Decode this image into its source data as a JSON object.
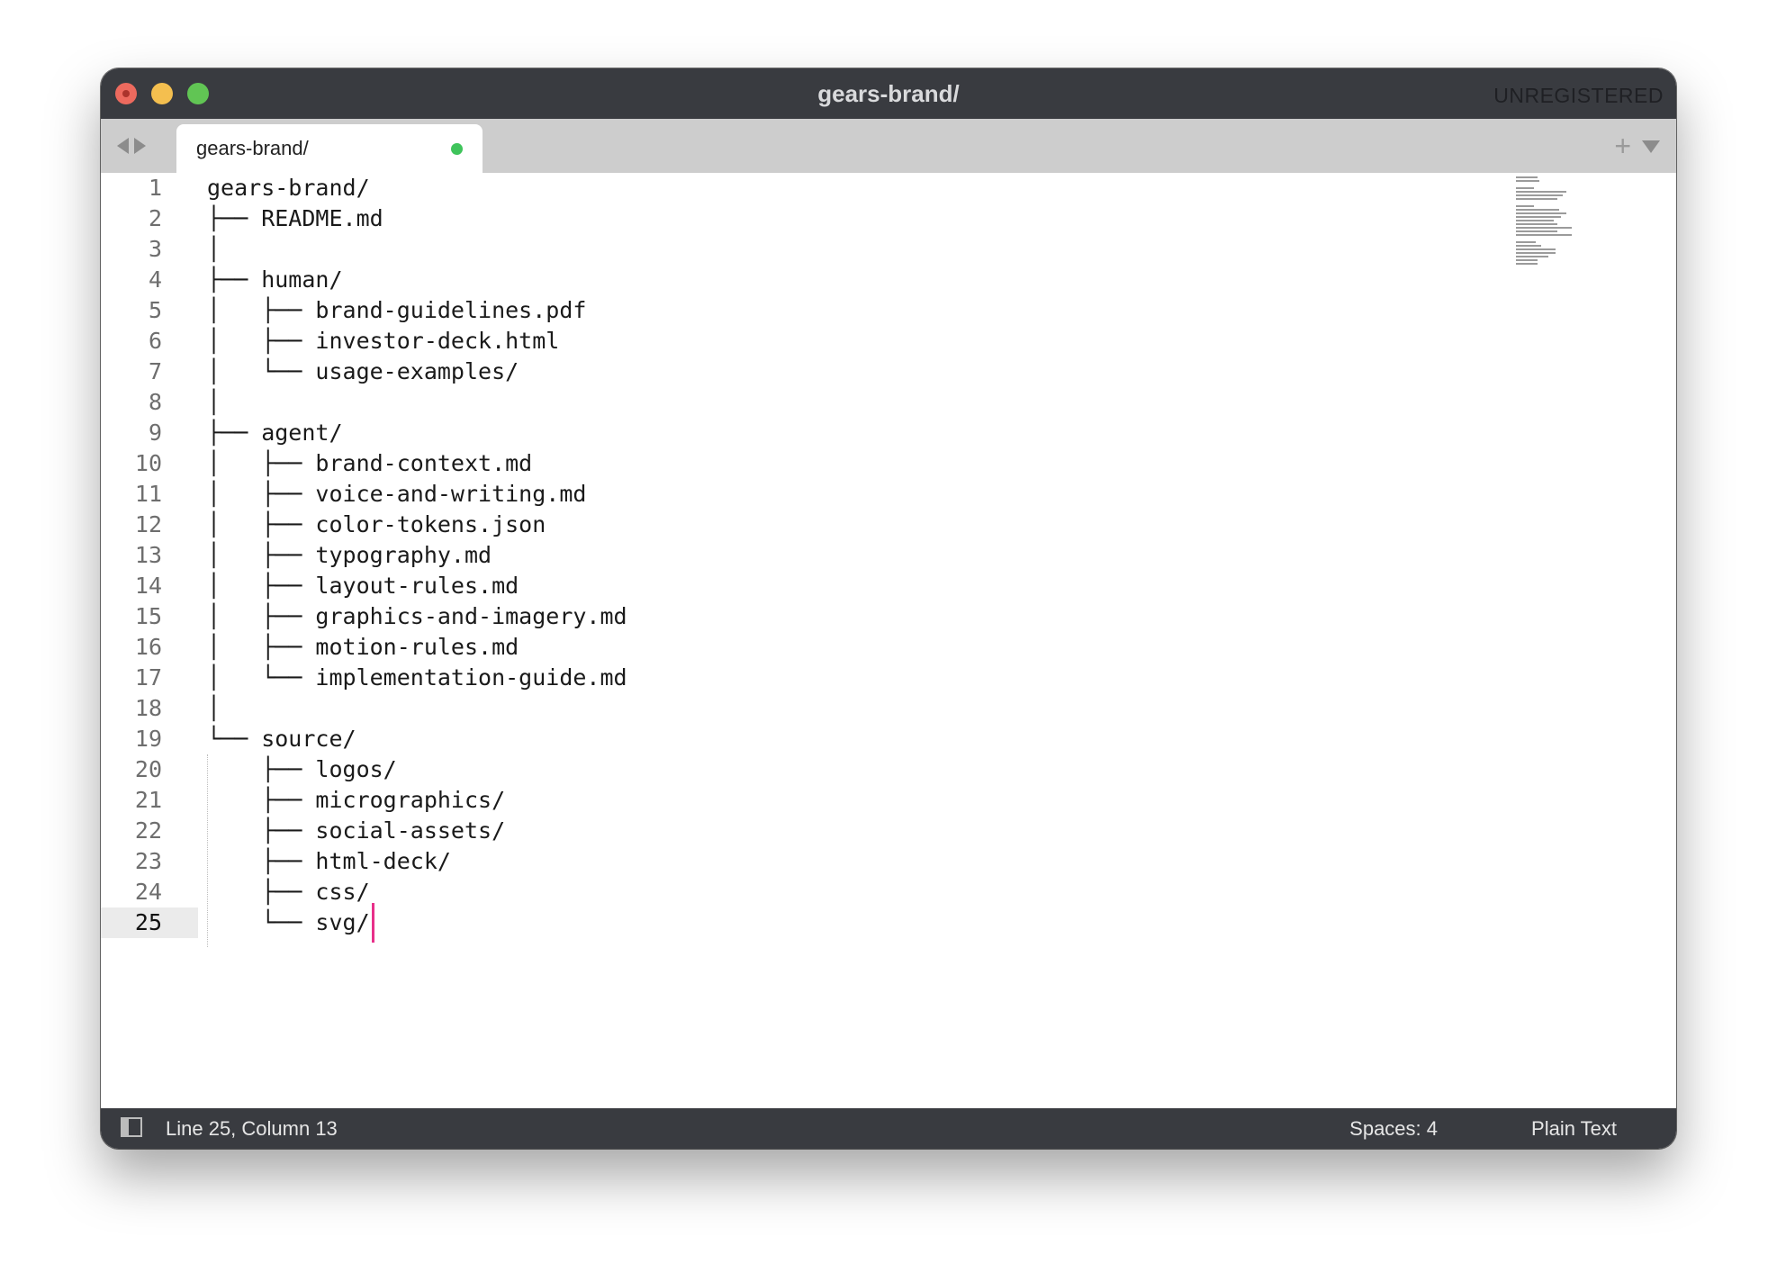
{
  "window": {
    "title": "gears-brand/",
    "license_badge": "UNREGISTERED"
  },
  "tabs": [
    {
      "label": "gears-brand/",
      "modified": true,
      "active": true
    }
  ],
  "editor": {
    "lines": [
      "gears-brand/",
      "├── README.md",
      "│",
      "├── human/",
      "│   ├── brand-guidelines.pdf",
      "│   ├── investor-deck.html",
      "│   └── usage-examples/",
      "│",
      "├── agent/",
      "│   ├── brand-context.md",
      "│   ├── voice-and-writing.md",
      "│   ├── color-tokens.json",
      "│   ├── typography.md",
      "│   ├── layout-rules.md",
      "│   ├── graphics-and-imagery.md",
      "│   ├── motion-rules.md",
      "│   └── implementation-guide.md",
      "│",
      "└── source/",
      "    ├── logos/",
      "    ├── micrographics/",
      "    ├── social-assets/",
      "    ├── html-deck/",
      "    ├── css/",
      "    └── svg/"
    ],
    "current_line": 25,
    "caret_color": "#e8308a"
  },
  "statusbar": {
    "position": "Line 25, Column 13",
    "indentation": "Spaces: 4",
    "syntax": "Plain Text"
  },
  "icons": {
    "traffic_lights": [
      "close-icon",
      "minimize-icon",
      "zoom-icon"
    ],
    "nav": [
      "back-arrow-icon",
      "forward-arrow-icon"
    ],
    "tabbar": [
      "new-tab-plus-icon",
      "tab-menu-chevron-icon"
    ],
    "status": "panel-toggle-icon"
  },
  "colors": {
    "titlebar": "#393b40",
    "tabbar": "#cdcdcd",
    "modified_dot": "#3fc45b"
  }
}
